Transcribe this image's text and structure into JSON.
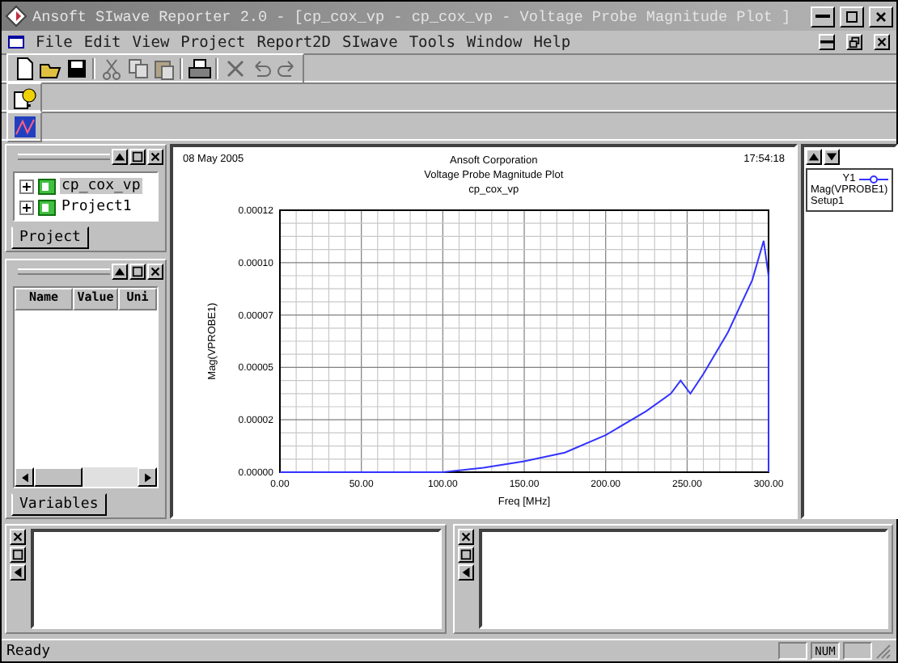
{
  "window": {
    "title": "Ansoft SIwave Reporter 2.0 - [cp_cox_vp - cp_cox_vp - Voltage Probe Magnitude Plot ]"
  },
  "menu": [
    "File",
    "Edit",
    "View",
    "Project",
    "Report2D",
    "SIwave",
    "Tools",
    "Window",
    "Help"
  ],
  "toolbar_groups": [
    {
      "buttons": [
        {
          "kind": "new",
          "disabled": false
        },
        {
          "kind": "open",
          "disabled": false
        },
        {
          "kind": "save",
          "disabled": false
        }
      ]
    },
    {
      "buttons": [
        {
          "kind": "cut",
          "disabled": true
        },
        {
          "kind": "copy",
          "disabled": true
        },
        {
          "kind": "paste",
          "disabled": true
        }
      ]
    },
    {
      "buttons": [
        {
          "kind": "print",
          "disabled": false
        }
      ]
    },
    {
      "buttons": [
        {
          "kind": "delete",
          "disabled": true
        },
        {
          "kind": "undo",
          "disabled": true
        },
        {
          "kind": "redo",
          "disabled": true
        }
      ]
    }
  ],
  "project_panel": {
    "tab": "Project",
    "tree": [
      {
        "label": "cp_cox_vp",
        "selected": true,
        "expanded": false
      },
      {
        "label": "Project1",
        "selected": false,
        "expanded": false
      }
    ]
  },
  "variables_panel": {
    "tab": "Variables",
    "columns": [
      "Name",
      "Value",
      "Uni"
    ]
  },
  "plot": {
    "date": "08 May 2005",
    "company": "Ansoft Corporation",
    "title": "Voltage Probe Magnitude Plot",
    "subtitle": "cp_cox_vp",
    "time": "17:54:18",
    "chart_data": {
      "type": "line",
      "xlabel": "Freq [MHz]",
      "ylabel": "Mag(VPROBE1)",
      "x": [
        0,
        50,
        100,
        125,
        150,
        175,
        200,
        225,
        240,
        246,
        252,
        260,
        275,
        290,
        297,
        300,
        300
      ],
      "series": [
        {
          "name": "Mag(VPROBE1)",
          "color": "#3333ff",
          "values": [
            0,
            0,
            0,
            2e-06,
            5e-06,
            9e-06,
            1.7e-05,
            2.8e-05,
            3.6e-05,
            4.2e-05,
            3.6e-05,
            4.5e-05,
            6.4e-05,
            8.8e-05,
            0.000106,
            9e-05,
            0
          ]
        }
      ],
      "grid": true,
      "xlim": [
        0,
        300
      ],
      "ylim": [
        0,
        0.00012
      ],
      "xticks": [
        {
          "value": 0,
          "label": "0.00"
        },
        {
          "value": 50,
          "label": "50.00"
        },
        {
          "value": 100,
          "label": "100.00"
        },
        {
          "value": 150,
          "label": "150.00"
        },
        {
          "value": 200,
          "label": "200.00"
        },
        {
          "value": 250,
          "label": "250.00"
        },
        {
          "value": 300,
          "label": "300.00"
        }
      ],
      "yticks": [
        {
          "value": 0,
          "label": "0.00000"
        },
        {
          "value": 2.4e-05,
          "label": "0.00002"
        },
        {
          "value": 4.8e-05,
          "label": "0.00005"
        },
        {
          "value": 7.2e-05,
          "label": "0.00007"
        },
        {
          "value": 9.6e-05,
          "label": "0.00010"
        },
        {
          "value": 0.00012,
          "label": "0.00012"
        }
      ]
    }
  },
  "legend": {
    "axis": "Y1",
    "setup": "Setup1"
  },
  "status_bar": {
    "message": "Ready",
    "indicator": "NUM"
  }
}
